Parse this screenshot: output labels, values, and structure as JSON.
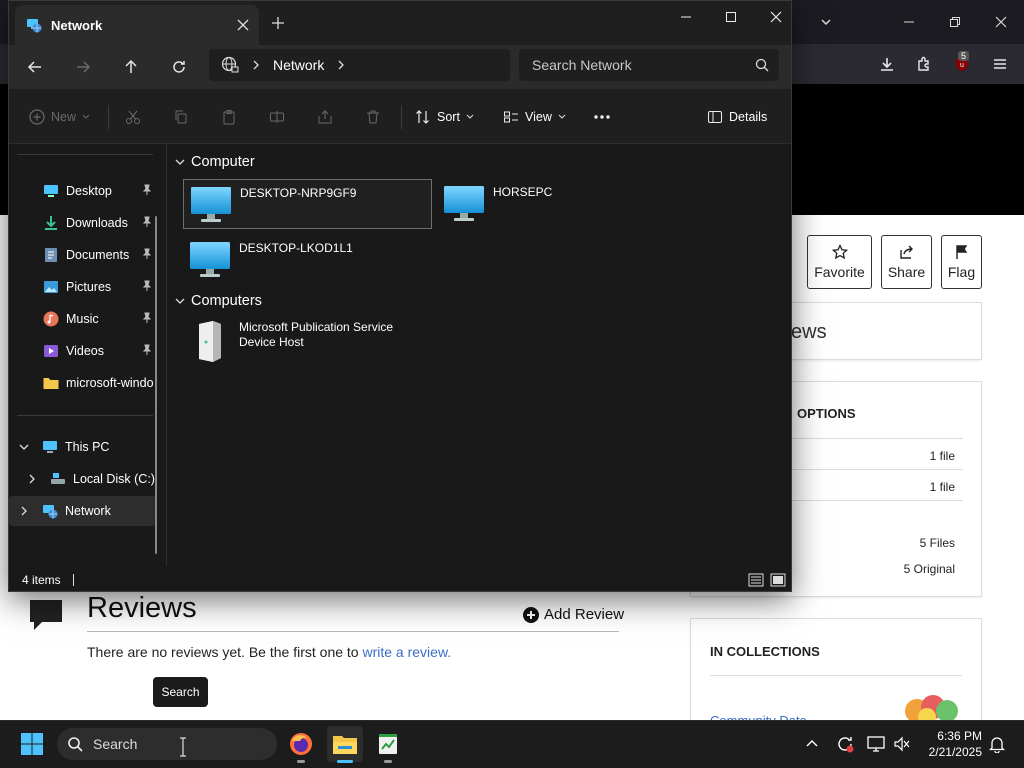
{
  "browser": {
    "ublock_count": "5",
    "actions": [
      {
        "label": "Favorite",
        "icon": "star-icon"
      },
      {
        "label": "Share",
        "icon": "share-icon"
      },
      {
        "label": "Flag",
        "icon": "flag-icon"
      }
    ],
    "reviews_panel_fragment": "ews",
    "options_heading_fragment": "OPTIONS",
    "options_rows": [
      "1 file",
      "1 file",
      "5 Files",
      "5 Original"
    ],
    "collections_heading": "IN COLLECTIONS",
    "collection_link_fragment": "Community Data",
    "reviews_title": "Reviews",
    "add_review": "Add Review",
    "no_reviews_text": "There are no reviews yet. Be the first one to ",
    "write_review_link": "write a review.",
    "search_tooltip": "Search"
  },
  "explorer": {
    "tab_title": "Network",
    "address_location": "Network",
    "search_placeholder": "Search Network",
    "commands": {
      "new": "New",
      "sort": "Sort",
      "view": "View",
      "details": "Details"
    },
    "nav_items": [
      {
        "label": "Desktop",
        "icon": "desktop-icon",
        "pinned": true
      },
      {
        "label": "Downloads",
        "icon": "downloads-icon",
        "pinned": true
      },
      {
        "label": "Documents",
        "icon": "documents-icon",
        "pinned": true
      },
      {
        "label": "Pictures",
        "icon": "pictures-icon",
        "pinned": true
      },
      {
        "label": "Music",
        "icon": "music-icon",
        "pinned": true
      },
      {
        "label": "Videos",
        "icon": "videos-icon",
        "pinned": true
      },
      {
        "label": "microsoft-windo",
        "icon": "folder-icon",
        "pinned": false
      }
    ],
    "tree": [
      {
        "label": "This PC",
        "icon": "pc-icon"
      },
      {
        "label": "Local Disk (C:)",
        "icon": "disk-icon"
      },
      {
        "label": "Network",
        "icon": "network-icon"
      }
    ],
    "groups": [
      {
        "title": "Computer",
        "items": [
          "DESKTOP-NRP9GF9",
          "HORSEPC",
          "DESKTOP-LKOD1L1"
        ]
      },
      {
        "title": "Computers",
        "items": [
          "Microsoft Publication Service Device Host"
        ]
      }
    ],
    "status_count": "4 items"
  },
  "taskbar": {
    "search_label": "Search",
    "time": "6:36 PM",
    "date": "2/21/2025"
  },
  "colors": {
    "explorer_bg": "#191919",
    "accent_blue": "#4cc2ff",
    "taskbar_bg": "#1c1c1c"
  }
}
